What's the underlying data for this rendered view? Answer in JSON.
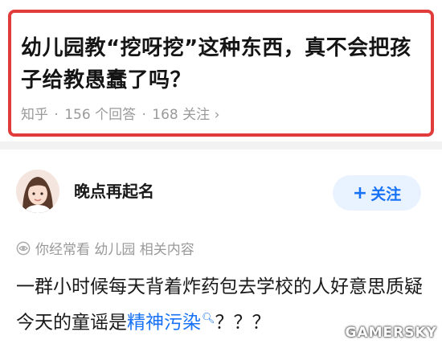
{
  "question": {
    "title": "幼儿园教“挖呀挖”这种东西，真不会把孩子给教愚蠢了吗？",
    "source": "知乎",
    "answers": "156 个回答",
    "followers": "168 关注",
    "chevron": "›"
  },
  "answer": {
    "author_name": "晚点再起名",
    "follow_label": "关注",
    "follow_plus": "+",
    "related_text": "你经常看 幼儿园 相关内容",
    "body_before": "一群小时候每天背着炸药包去学校的人好意思质疑今天的童谣是",
    "body_link": "精神污染",
    "body_after": "？？？"
  },
  "watermark": {
    "text": "GAMERSKY"
  },
  "colors": {
    "highlight_border": "#e23b3b",
    "link_blue": "#1772f6",
    "follow_bg": "#e9f3ff",
    "meta_gray": "#9a9a9a"
  },
  "icons": {
    "avatar": "avatar",
    "related": "eye-icon",
    "search": "search-icon"
  }
}
